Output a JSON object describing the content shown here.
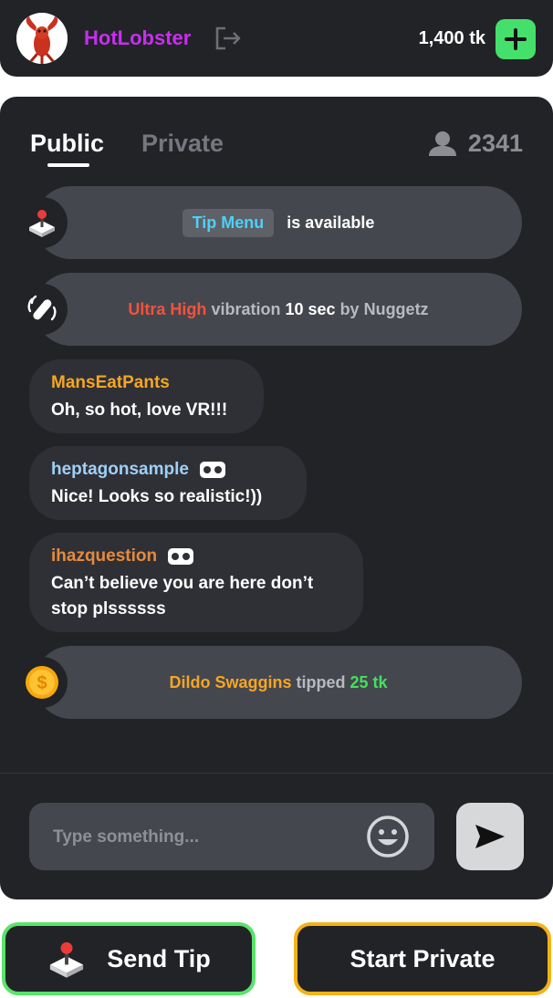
{
  "header": {
    "username": "HotLobster",
    "balance": "1,400 tk"
  },
  "chat": {
    "tabs": [
      "Public",
      "Private"
    ],
    "viewer_count": "2341",
    "messages": [
      {
        "type": "system",
        "icon": "tip-menu-joystick-icon",
        "tag": "Tip Menu",
        "text": "is available"
      },
      {
        "type": "system",
        "icon": "vibration-icon",
        "level": "Ultra High",
        "mid": "vibration",
        "duration": "10 sec",
        "by": "by Nuggetz"
      },
      {
        "type": "user",
        "user": "MansEatPants",
        "user_color": "#f5a623",
        "text": "Oh, so hot, love VR!!!"
      },
      {
        "type": "user",
        "user": "heptagonsample",
        "user_color": "#9fd0f7",
        "vr": true,
        "text": "Nice! Looks so realistic!))"
      },
      {
        "type": "user",
        "user": "ihazquestion",
        "user_color": "#e58a3c",
        "vr": true,
        "text": "Can’t believe you are here don’t stop plssssss"
      },
      {
        "type": "system",
        "icon": "coin-icon",
        "tipper": "Dildo Swaggins",
        "mid": "tipped",
        "amount": "25 tk"
      }
    ],
    "input_placeholder": "Type something..."
  },
  "actions": {
    "send_tip": "Send Tip",
    "start_private": "Start Private"
  },
  "colors": {
    "background": "#222327",
    "username": "#c92ef0",
    "accent_green": "#45e06b",
    "accent_orange": "#f5b216",
    "tip_menu": "#4fd0f5",
    "vibration_level": "#f2533c"
  }
}
